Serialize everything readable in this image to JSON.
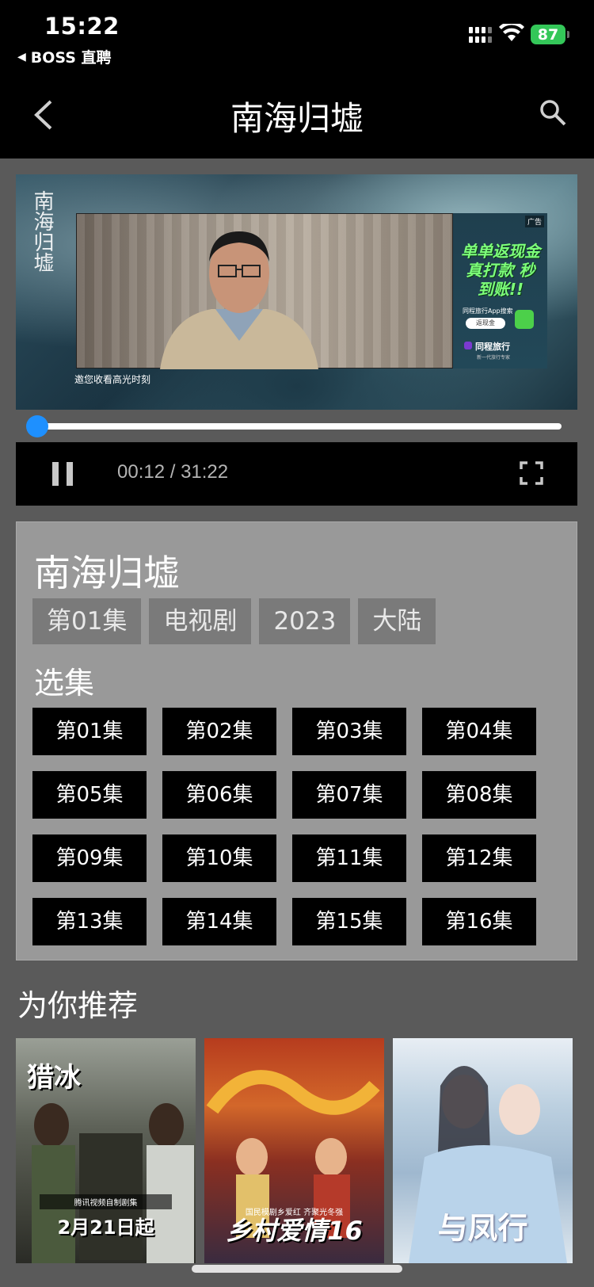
{
  "status_bar": {
    "time": "15:22",
    "back_app": "BOSS 直聘",
    "battery": "87"
  },
  "nav": {
    "title": "南海归墟"
  },
  "video": {
    "logo_text": "南海归墟",
    "ad_tag": "广告",
    "ad_headline": "单单返现金 真打款 秒到账!!",
    "ad_small": "同程旅行App搜索",
    "ad_button": "返现金",
    "ad_brand": "同程旅行",
    "ad_slogan": "新一代旅行专家",
    "caption": "邀您收看高光时刻",
    "progress_fraction": 0.0064
  },
  "controls": {
    "time_display": "00:12 / 31:22"
  },
  "info": {
    "title": "南海归墟",
    "tags": [
      "第01集",
      "电视剧",
      "2023",
      "大陆"
    ],
    "section_title": "选集",
    "episodes": [
      "第01集",
      "第02集",
      "第03集",
      "第04集",
      "第05集",
      "第06集",
      "第07集",
      "第08集",
      "第09集",
      "第10集",
      "第11集",
      "第12集",
      "第13集",
      "第14集",
      "第15集",
      "第16集"
    ]
  },
  "recommend": {
    "title": "为你推荐",
    "posters": [
      {
        "top": "猎冰",
        "line": "腾讯视频自制剧集",
        "title": "2月21日起"
      },
      {
        "top": "",
        "line": "国民模剧乡爱红 齐聚光冬强",
        "title": "乡村爱情16"
      },
      {
        "top": "",
        "line": "",
        "title": "与凤行"
      }
    ]
  },
  "colors": {
    "accent": "#1e90ff",
    "battery": "#34c759",
    "background": "#5a5a5a",
    "panel": "#999999"
  }
}
